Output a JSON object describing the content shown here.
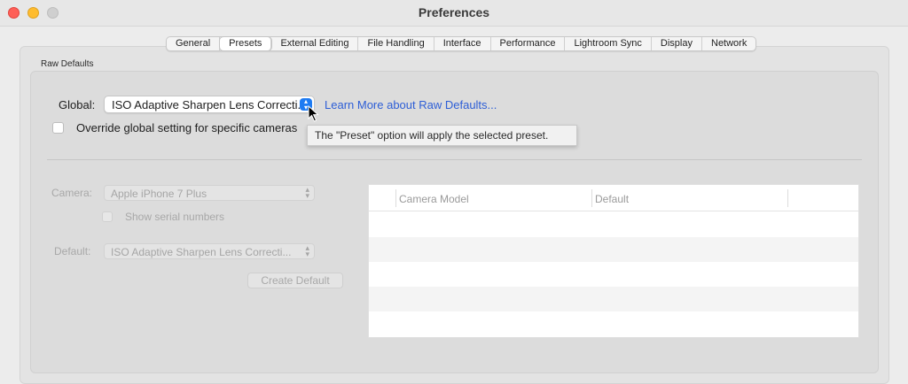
{
  "window": {
    "title": "Preferences"
  },
  "tabs": [
    {
      "label": "General",
      "active": false
    },
    {
      "label": "Presets",
      "active": true
    },
    {
      "label": "External Editing",
      "active": false
    },
    {
      "label": "File Handling",
      "active": false
    },
    {
      "label": "Interface",
      "active": false
    },
    {
      "label": "Performance",
      "active": false
    },
    {
      "label": "Lightroom Sync",
      "active": false
    },
    {
      "label": "Display",
      "active": false
    },
    {
      "label": "Network",
      "active": false
    }
  ],
  "raw_defaults": {
    "section_title": "Raw Defaults",
    "global_label": "Global:",
    "global_value": "ISO Adaptive Sharpen Lens Correcti...",
    "learn_more_link": "Learn More about Raw Defaults...",
    "override_label": "Override global setting for specific cameras",
    "override_checked": false,
    "tooltip": "The \"Preset\" option will apply the selected preset."
  },
  "camera_settings": {
    "camera_label": "Camera:",
    "camera_value": "Apple iPhone 7 Plus",
    "serial_label": "Show serial numbers",
    "default_label": "Default:",
    "default_value": "ISO Adaptive Sharpen Lens Correcti...",
    "create_button": "Create Default"
  },
  "table": {
    "columns": [
      "Camera Model",
      "Default"
    ],
    "rows": []
  },
  "colors": {
    "accent_blue": "#1e7bf2",
    "link_blue": "#2d5ed6",
    "close": "#fe5f57",
    "minimize": "#febc2e"
  }
}
